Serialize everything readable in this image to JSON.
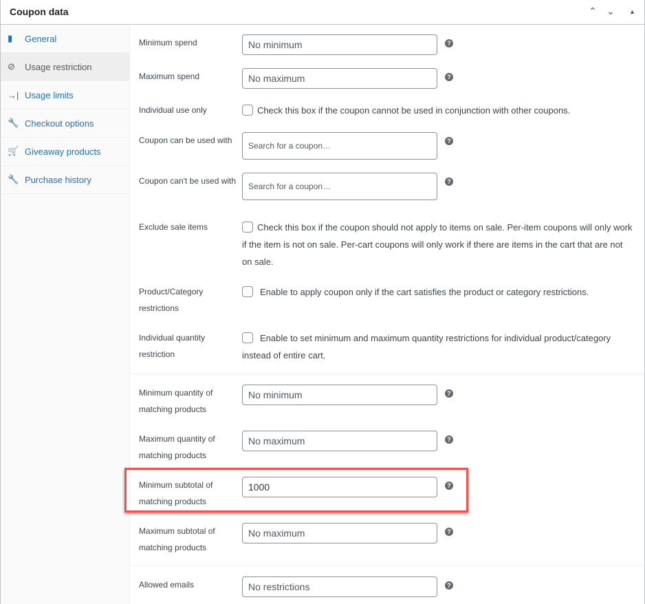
{
  "header": {
    "title": "Coupon data",
    "up_icon": "chevron-up-icon",
    "down_icon": "chevron-down-icon",
    "toggle_icon": "triangle-up-icon"
  },
  "sidebar": {
    "items": [
      {
        "label": "General",
        "icon": "ticket-icon",
        "active": false
      },
      {
        "label": "Usage restriction",
        "icon": "ban-icon",
        "active": true
      },
      {
        "label": "Usage limits",
        "icon": "limits-icon",
        "active": false
      },
      {
        "label": "Checkout options",
        "icon": "wrench-icon",
        "active": false
      },
      {
        "label": "Giveaway products",
        "icon": "cart-icon",
        "active": false
      },
      {
        "label": "Purchase history",
        "icon": "wrench-icon",
        "active": false
      }
    ]
  },
  "fields": {
    "min_spend": {
      "label": "Minimum spend",
      "placeholder": "No minimum"
    },
    "max_spend": {
      "label": "Maximum spend",
      "placeholder": "No maximum"
    },
    "individual_use": {
      "label": "Individual use only",
      "text": "Check this box if the coupon cannot be used in conjunction with other coupons."
    },
    "can_use_with": {
      "label": "Coupon can be used with",
      "placeholder": "Search for a coupon…"
    },
    "cant_use_with": {
      "label": "Coupon can't be used with",
      "placeholder": "Search for a coupon…"
    },
    "exclude_sale": {
      "label": "Exclude sale items",
      "text": "Check this box if the coupon should not apply to items on sale. Per-item coupons will only work if the item is not on sale. Per-cart coupons will only work if there are items in the cart that are not on sale."
    },
    "product_category": {
      "label": "Product/Category restrictions",
      "text": "Enable to apply coupon only if the cart satisfies the product or category restrictions."
    },
    "individual_quantity": {
      "label": "Individual quantity restriction",
      "text": "Enable to set minimum and maximum quantity restrictions for individual product/category instead of entire cart."
    },
    "min_qty": {
      "label": "Minimum quantity of matching products",
      "placeholder": "No minimum"
    },
    "max_qty": {
      "label": "Maximum quantity of matching products",
      "placeholder": "No maximum"
    },
    "min_subtotal": {
      "label": "Minimum subtotal of matching products",
      "value": "1000"
    },
    "max_subtotal": {
      "label": "Maximum subtotal of matching products",
      "placeholder": "No maximum"
    },
    "allowed_emails": {
      "label": "Allowed emails",
      "placeholder": "No restrictions"
    }
  },
  "help_glyph": "?",
  "highlight_color": "#f0544f"
}
